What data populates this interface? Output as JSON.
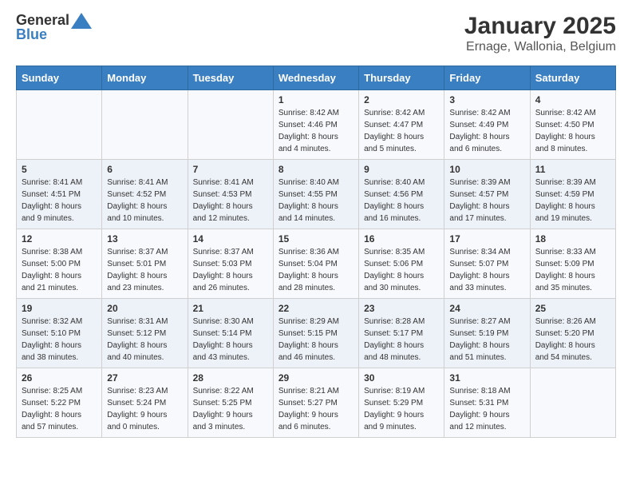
{
  "header": {
    "logo_general": "General",
    "logo_blue": "Blue",
    "title": "January 2025",
    "subtitle": "Ernage, Wallonia, Belgium"
  },
  "days_of_week": [
    "Sunday",
    "Monday",
    "Tuesday",
    "Wednesday",
    "Thursday",
    "Friday",
    "Saturday"
  ],
  "weeks": [
    [
      {
        "day": "",
        "info": ""
      },
      {
        "day": "",
        "info": ""
      },
      {
        "day": "",
        "info": ""
      },
      {
        "day": "1",
        "info": "Sunrise: 8:42 AM\nSunset: 4:46 PM\nDaylight: 8 hours\nand 4 minutes."
      },
      {
        "day": "2",
        "info": "Sunrise: 8:42 AM\nSunset: 4:47 PM\nDaylight: 8 hours\nand 5 minutes."
      },
      {
        "day": "3",
        "info": "Sunrise: 8:42 AM\nSunset: 4:49 PM\nDaylight: 8 hours\nand 6 minutes."
      },
      {
        "day": "4",
        "info": "Sunrise: 8:42 AM\nSunset: 4:50 PM\nDaylight: 8 hours\nand 8 minutes."
      }
    ],
    [
      {
        "day": "5",
        "info": "Sunrise: 8:41 AM\nSunset: 4:51 PM\nDaylight: 8 hours\nand 9 minutes."
      },
      {
        "day": "6",
        "info": "Sunrise: 8:41 AM\nSunset: 4:52 PM\nDaylight: 8 hours\nand 10 minutes."
      },
      {
        "day": "7",
        "info": "Sunrise: 8:41 AM\nSunset: 4:53 PM\nDaylight: 8 hours\nand 12 minutes."
      },
      {
        "day": "8",
        "info": "Sunrise: 8:40 AM\nSunset: 4:55 PM\nDaylight: 8 hours\nand 14 minutes."
      },
      {
        "day": "9",
        "info": "Sunrise: 8:40 AM\nSunset: 4:56 PM\nDaylight: 8 hours\nand 16 minutes."
      },
      {
        "day": "10",
        "info": "Sunrise: 8:39 AM\nSunset: 4:57 PM\nDaylight: 8 hours\nand 17 minutes."
      },
      {
        "day": "11",
        "info": "Sunrise: 8:39 AM\nSunset: 4:59 PM\nDaylight: 8 hours\nand 19 minutes."
      }
    ],
    [
      {
        "day": "12",
        "info": "Sunrise: 8:38 AM\nSunset: 5:00 PM\nDaylight: 8 hours\nand 21 minutes."
      },
      {
        "day": "13",
        "info": "Sunrise: 8:37 AM\nSunset: 5:01 PM\nDaylight: 8 hours\nand 23 minutes."
      },
      {
        "day": "14",
        "info": "Sunrise: 8:37 AM\nSunset: 5:03 PM\nDaylight: 8 hours\nand 26 minutes."
      },
      {
        "day": "15",
        "info": "Sunrise: 8:36 AM\nSunset: 5:04 PM\nDaylight: 8 hours\nand 28 minutes."
      },
      {
        "day": "16",
        "info": "Sunrise: 8:35 AM\nSunset: 5:06 PM\nDaylight: 8 hours\nand 30 minutes."
      },
      {
        "day": "17",
        "info": "Sunrise: 8:34 AM\nSunset: 5:07 PM\nDaylight: 8 hours\nand 33 minutes."
      },
      {
        "day": "18",
        "info": "Sunrise: 8:33 AM\nSunset: 5:09 PM\nDaylight: 8 hours\nand 35 minutes."
      }
    ],
    [
      {
        "day": "19",
        "info": "Sunrise: 8:32 AM\nSunset: 5:10 PM\nDaylight: 8 hours\nand 38 minutes."
      },
      {
        "day": "20",
        "info": "Sunrise: 8:31 AM\nSunset: 5:12 PM\nDaylight: 8 hours\nand 40 minutes."
      },
      {
        "day": "21",
        "info": "Sunrise: 8:30 AM\nSunset: 5:14 PM\nDaylight: 8 hours\nand 43 minutes."
      },
      {
        "day": "22",
        "info": "Sunrise: 8:29 AM\nSunset: 5:15 PM\nDaylight: 8 hours\nand 46 minutes."
      },
      {
        "day": "23",
        "info": "Sunrise: 8:28 AM\nSunset: 5:17 PM\nDaylight: 8 hours\nand 48 minutes."
      },
      {
        "day": "24",
        "info": "Sunrise: 8:27 AM\nSunset: 5:19 PM\nDaylight: 8 hours\nand 51 minutes."
      },
      {
        "day": "25",
        "info": "Sunrise: 8:26 AM\nSunset: 5:20 PM\nDaylight: 8 hours\nand 54 minutes."
      }
    ],
    [
      {
        "day": "26",
        "info": "Sunrise: 8:25 AM\nSunset: 5:22 PM\nDaylight: 8 hours\nand 57 minutes."
      },
      {
        "day": "27",
        "info": "Sunrise: 8:23 AM\nSunset: 5:24 PM\nDaylight: 9 hours\nand 0 minutes."
      },
      {
        "day": "28",
        "info": "Sunrise: 8:22 AM\nSunset: 5:25 PM\nDaylight: 9 hours\nand 3 minutes."
      },
      {
        "day": "29",
        "info": "Sunrise: 8:21 AM\nSunset: 5:27 PM\nDaylight: 9 hours\nand 6 minutes."
      },
      {
        "day": "30",
        "info": "Sunrise: 8:19 AM\nSunset: 5:29 PM\nDaylight: 9 hours\nand 9 minutes."
      },
      {
        "day": "31",
        "info": "Sunrise: 8:18 AM\nSunset: 5:31 PM\nDaylight: 9 hours\nand 12 minutes."
      },
      {
        "day": "",
        "info": ""
      }
    ]
  ]
}
